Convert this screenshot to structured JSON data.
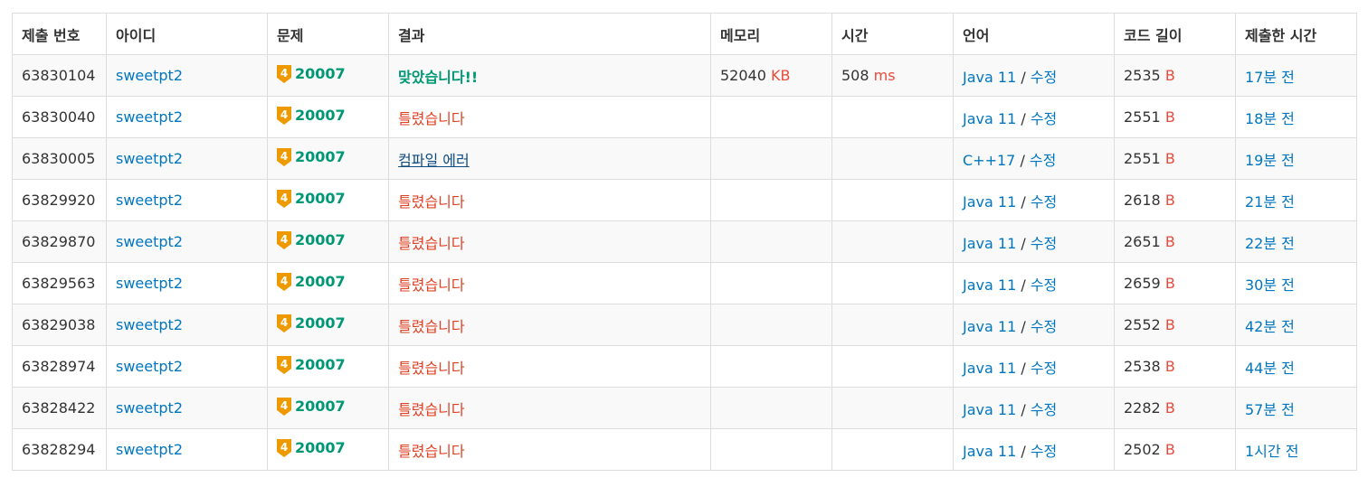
{
  "headers": [
    "제출 번호",
    "아이디",
    "문제",
    "결과",
    "메모리",
    "시간",
    "언어",
    "코드 길이",
    "제출한 시간"
  ],
  "colors": {
    "link": "#0076c0",
    "unit": "#e74c3c",
    "accepted": "#009874",
    "wrong": "#dd4124",
    "compile_error": "#0f4c81",
    "tier_badge": "#ec9a00"
  },
  "tier_level": "4",
  "lang_separator": "/",
  "rows": [
    {
      "id": "63830104",
      "user": "sweetpt2",
      "problem": "20007",
      "result": "맞았습니다!!",
      "result_type": "ok",
      "memory": "52040",
      "memory_unit": "KB",
      "time": "508",
      "time_unit": "ms",
      "lang": "Java 11",
      "edit": "수정",
      "length": "2535",
      "length_unit": "B",
      "submitted": "17분 전"
    },
    {
      "id": "63830040",
      "user": "sweetpt2",
      "problem": "20007",
      "result": "틀렸습니다",
      "result_type": "wrong",
      "memory": "",
      "memory_unit": "",
      "time": "",
      "time_unit": "",
      "lang": "Java 11",
      "edit": "수정",
      "length": "2551",
      "length_unit": "B",
      "submitted": "18분 전"
    },
    {
      "id": "63830005",
      "user": "sweetpt2",
      "problem": "20007",
      "result": "컴파일 에러",
      "result_type": "ce",
      "memory": "",
      "memory_unit": "",
      "time": "",
      "time_unit": "",
      "lang": "C++17",
      "edit": "수정",
      "length": "2551",
      "length_unit": "B",
      "submitted": "19분 전"
    },
    {
      "id": "63829920",
      "user": "sweetpt2",
      "problem": "20007",
      "result": "틀렸습니다",
      "result_type": "wrong",
      "memory": "",
      "memory_unit": "",
      "time": "",
      "time_unit": "",
      "lang": "Java 11",
      "edit": "수정",
      "length": "2618",
      "length_unit": "B",
      "submitted": "21분 전"
    },
    {
      "id": "63829870",
      "user": "sweetpt2",
      "problem": "20007",
      "result": "틀렸습니다",
      "result_type": "wrong",
      "memory": "",
      "memory_unit": "",
      "time": "",
      "time_unit": "",
      "lang": "Java 11",
      "edit": "수정",
      "length": "2651",
      "length_unit": "B",
      "submitted": "22분 전"
    },
    {
      "id": "63829563",
      "user": "sweetpt2",
      "problem": "20007",
      "result": "틀렸습니다",
      "result_type": "wrong",
      "memory": "",
      "memory_unit": "",
      "time": "",
      "time_unit": "",
      "lang": "Java 11",
      "edit": "수정",
      "length": "2659",
      "length_unit": "B",
      "submitted": "30분 전"
    },
    {
      "id": "63829038",
      "user": "sweetpt2",
      "problem": "20007",
      "result": "틀렸습니다",
      "result_type": "wrong",
      "memory": "",
      "memory_unit": "",
      "time": "",
      "time_unit": "",
      "lang": "Java 11",
      "edit": "수정",
      "length": "2552",
      "length_unit": "B",
      "submitted": "42분 전"
    },
    {
      "id": "63828974",
      "user": "sweetpt2",
      "problem": "20007",
      "result": "틀렸습니다",
      "result_type": "wrong",
      "memory": "",
      "memory_unit": "",
      "time": "",
      "time_unit": "",
      "lang": "Java 11",
      "edit": "수정",
      "length": "2538",
      "length_unit": "B",
      "submitted": "44분 전"
    },
    {
      "id": "63828422",
      "user": "sweetpt2",
      "problem": "20007",
      "result": "틀렸습니다",
      "result_type": "wrong",
      "memory": "",
      "memory_unit": "",
      "time": "",
      "time_unit": "",
      "lang": "Java 11",
      "edit": "수정",
      "length": "2282",
      "length_unit": "B",
      "submitted": "57분 전"
    },
    {
      "id": "63828294",
      "user": "sweetpt2",
      "problem": "20007",
      "result": "틀렸습니다",
      "result_type": "wrong",
      "memory": "",
      "memory_unit": "",
      "time": "",
      "time_unit": "",
      "lang": "Java 11",
      "edit": "수정",
      "length": "2502",
      "length_unit": "B",
      "submitted": "1시간 전"
    }
  ]
}
